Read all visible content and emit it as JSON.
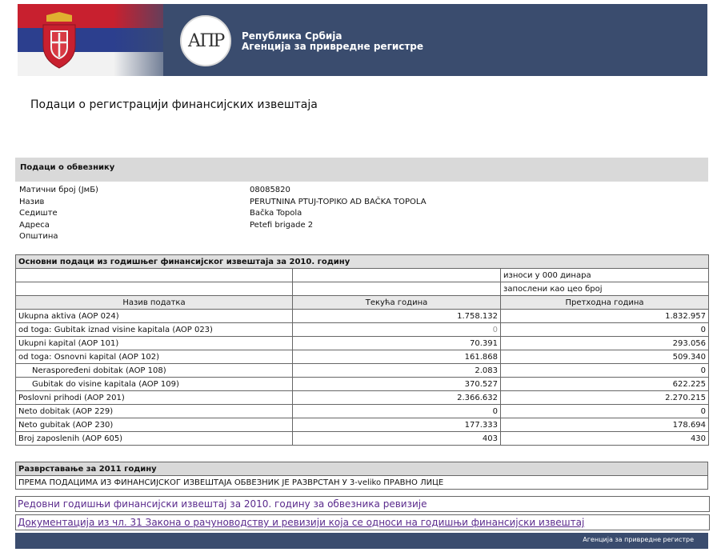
{
  "header": {
    "logo_text": "АПР",
    "agency_line1": "Република Србија",
    "agency_line2": "Агенција за привредне регистре",
    "flag_colors": [
      "#c8202f",
      "#2c3f8e",
      "#f2f2f2"
    ]
  },
  "page_title": "Подаци о регистрацији финансијских извештаја",
  "obveznik": {
    "section_title": "Подаци о обвезнику",
    "fields": [
      {
        "label": "Матични број (ЈмБ)",
        "value": "08085820"
      },
      {
        "label": "Назив",
        "value": "PERUTNINA PTUJ-TOPIKO AD BAČKA TOPOLA"
      },
      {
        "label": "Седиште",
        "value": "Bačka Topola"
      },
      {
        "label": "Адреса",
        "value": "Petefi brigade 2"
      },
      {
        "label": "Општина",
        "value": ""
      }
    ]
  },
  "financial": {
    "title": "Основни подаци из годишњег финансијског извештаја за 2010. годину",
    "unit_note": "износи у 000 динара",
    "employees_note": "запослени као цео број",
    "columns": [
      "Назив податка",
      "Текућа година",
      "Претходна година"
    ],
    "rows": [
      {
        "name": "Ukupna aktiva (AOP 024)",
        "current": "1.758.132",
        "previous": "1.832.957",
        "indent": false
      },
      {
        "name": "od toga: Gubitak iznad visine kapitala (AOP 023)",
        "current": "0",
        "previous": "0",
        "indent": false
      },
      {
        "name": "Ukupni kapital (AOP 101)",
        "current": "70.391",
        "previous": "293.056",
        "indent": false
      },
      {
        "name": "od toga: Osnovni kapital (AOP 102)",
        "current": "161.868",
        "previous": "509.340",
        "indent": false
      },
      {
        "name": "Neraspoređeni dobitak (AOP 108)",
        "current": "2.083",
        "previous": "0",
        "indent": true
      },
      {
        "name": "Gubitak do visine kapitala (AOP 109)",
        "current": "370.527",
        "previous": "622.225",
        "indent": true
      },
      {
        "name": "Poslovni prihodi (AOP 201)",
        "current": "2.366.632",
        "previous": "2.270.215",
        "indent": false
      },
      {
        "name": "Neto dobitak (AOP 229)",
        "current": "0",
        "previous": "0",
        "indent": false
      },
      {
        "name": "Neto gubitak (AOP 230)",
        "current": "177.333",
        "previous": "178.694",
        "indent": false
      },
      {
        "name": "Broj zaposlenih (AOP 605)",
        "current": "403",
        "previous": "430",
        "indent": false
      }
    ]
  },
  "rank": {
    "title": "Разврставање за 2011 годину",
    "text": "ПРЕМА ПОДАЦИМА ИЗ ФИНАНСИЈСКОГ ИЗВЕШТАЈА ОБВЕЗНИК ЈЕ РАЗВРСТАН У 3-veliko ПРАВНО ЛИЦЕ"
  },
  "links": {
    "annual_report": "Редовни годишњи финансијски извештај за 2010. годину за обвезника ревизије",
    "documentation": "Документација из чл. 31 Закона о рачуноводству и ревизији која се односи на годишњи финансијски извештај"
  },
  "footer": {
    "text": "Агенција за привредне регистре"
  }
}
